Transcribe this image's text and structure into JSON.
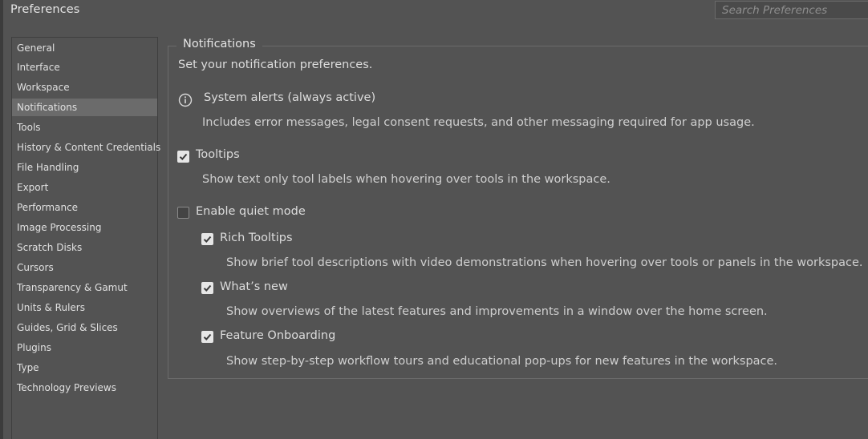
{
  "window": {
    "title": "Preferences"
  },
  "search": {
    "placeholder": "Search Preferences"
  },
  "sidebar": {
    "items": [
      {
        "label": "General",
        "selected": false
      },
      {
        "label": "Interface",
        "selected": false
      },
      {
        "label": "Workspace",
        "selected": false
      },
      {
        "label": "Notifications",
        "selected": true
      },
      {
        "label": "Tools",
        "selected": false
      },
      {
        "label": "History & Content Credentials",
        "selected": false
      },
      {
        "label": "File Handling",
        "selected": false
      },
      {
        "label": "Export",
        "selected": false
      },
      {
        "label": "Performance",
        "selected": false
      },
      {
        "label": "Image Processing",
        "selected": false
      },
      {
        "label": "Scratch Disks",
        "selected": false
      },
      {
        "label": "Cursors",
        "selected": false
      },
      {
        "label": "Transparency & Gamut",
        "selected": false
      },
      {
        "label": "Units & Rulers",
        "selected": false
      },
      {
        "label": "Guides, Grid & Slices",
        "selected": false
      },
      {
        "label": "Plugins",
        "selected": false
      },
      {
        "label": "Type",
        "selected": false
      },
      {
        "label": "Technology Previews",
        "selected": false
      }
    ]
  },
  "panel": {
    "title": "Notifications",
    "intro": "Set your notification preferences.",
    "system_alerts": {
      "label": "System alerts (always active)",
      "description": "Includes error messages, legal consent requests, and other messaging required for app usage.",
      "icon": "info-icon"
    },
    "tooltips": {
      "label": "Tooltips",
      "checked": true,
      "description": "Show text only tool labels when hovering over tools in the workspace."
    },
    "quiet_mode": {
      "label": "Enable quiet mode",
      "checked": false
    },
    "rich_tooltips": {
      "label": "Rich Tooltips",
      "checked": true,
      "description": "Show brief tool descriptions with video demonstrations when hovering over tools or panels in the workspace."
    },
    "whats_new": {
      "label": "What’s new",
      "checked": true,
      "description": "Show overviews of the latest features and improvements in a window over the home screen."
    },
    "feature_onboarding": {
      "label": "Feature Onboarding",
      "checked": true,
      "description": "Show step-by-step workflow tours and educational pop-ups for new features in the workspace."
    }
  },
  "colors": {
    "background": "#535353",
    "selected_item": "#6b6b6b",
    "text": "#dcdcdc",
    "checkbox_checked": "#e6e6e6"
  }
}
